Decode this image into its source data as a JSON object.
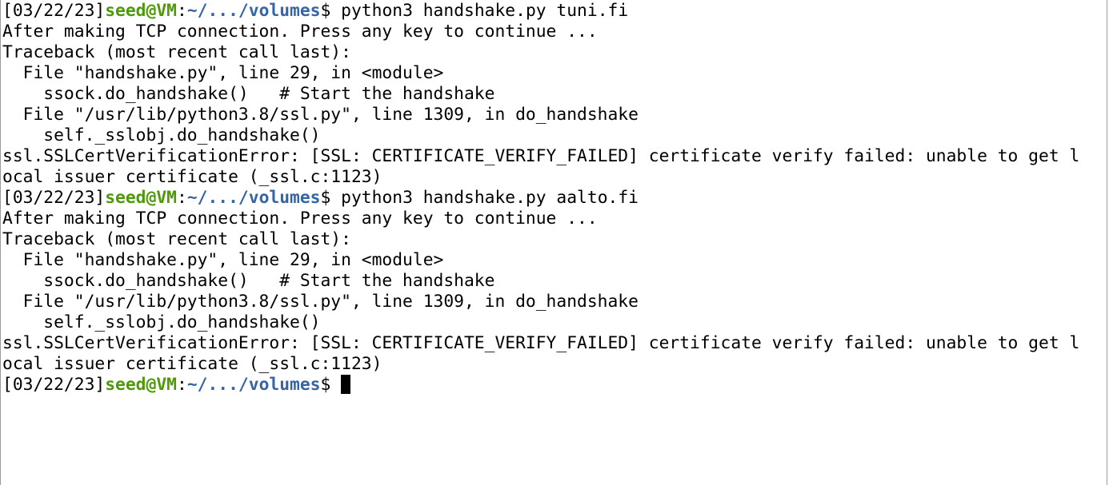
{
  "terminal": {
    "prompt": {
      "date": "[03/22/23]",
      "user_host": "seed@VM",
      "separator": ":",
      "cwd": "~/.../volumes",
      "symbol": "$ "
    },
    "lines": [
      {
        "type": "prompt",
        "command": "python3 handshake.py tuni.fi"
      },
      {
        "type": "output",
        "text": "After making TCP connection. Press any key to continue ..."
      },
      {
        "type": "output",
        "text": "Traceback (most recent call last):"
      },
      {
        "type": "output",
        "text": "  File \"handshake.py\", line 29, in <module>"
      },
      {
        "type": "output",
        "text": "    ssock.do_handshake()   # Start the handshake"
      },
      {
        "type": "output",
        "text": "  File \"/usr/lib/python3.8/ssl.py\", line 1309, in do_handshake"
      },
      {
        "type": "output",
        "text": "    self._sslobj.do_handshake()"
      },
      {
        "type": "output",
        "text": "ssl.SSLCertVerificationError: [SSL: CERTIFICATE_VERIFY_FAILED] certificate verify failed: unable to get l"
      },
      {
        "type": "output",
        "text": "ocal issuer certificate (_ssl.c:1123)"
      },
      {
        "type": "prompt",
        "command": "python3 handshake.py aalto.fi"
      },
      {
        "type": "output",
        "text": "After making TCP connection. Press any key to continue ..."
      },
      {
        "type": "output",
        "text": "Traceback (most recent call last):"
      },
      {
        "type": "output",
        "text": "  File \"handshake.py\", line 29, in <module>"
      },
      {
        "type": "output",
        "text": "    ssock.do_handshake()   # Start the handshake"
      },
      {
        "type": "output",
        "text": "  File \"/usr/lib/python3.8/ssl.py\", line 1309, in do_handshake"
      },
      {
        "type": "output",
        "text": "    self._sslobj.do_handshake()"
      },
      {
        "type": "output",
        "text": "ssl.SSLCertVerificationError: [SSL: CERTIFICATE_VERIFY_FAILED] certificate verify failed: unable to get l"
      },
      {
        "type": "output",
        "text": "ocal issuer certificate (_ssl.c:1123)"
      },
      {
        "type": "prompt",
        "command": "",
        "cursor": true
      }
    ]
  }
}
